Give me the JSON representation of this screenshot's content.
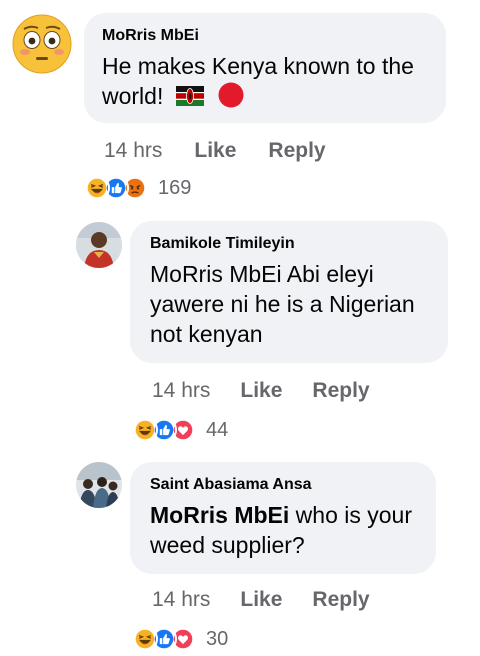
{
  "comments": [
    {
      "author": "MoRris MbEi",
      "mention": "",
      "text": "He makes Kenya known to the world!",
      "time": "14 hrs",
      "like_label": "Like",
      "reply_label": "Reply",
      "reaction_count": "169",
      "reactions": [
        "haha-icon",
        "like-icon",
        "angry-icon"
      ],
      "avatar_icon": "flushed-emoji-icon"
    },
    {
      "author": "Bamikole Timileyin",
      "mention": "",
      "text": "MoRris MbEi Abi eleyi yawere ni  he is a Nigerian not kenyan",
      "time": "14 hrs",
      "like_label": "Like",
      "reply_label": "Reply",
      "reaction_count": "44",
      "reactions": [
        "haha-icon",
        "like-icon",
        "love-icon"
      ],
      "avatar_icon": "user-photo-avatar"
    },
    {
      "author": "Saint Abasiama Ansa",
      "mention": "MoRris MbEi",
      "text": " who is your weed supplier?",
      "time": "14 hrs",
      "like_label": "Like",
      "reply_label": "Reply",
      "reaction_count": "30",
      "reactions": [
        "haha-icon",
        "like-icon",
        "love-icon"
      ],
      "avatar_icon": "group-photo-avatar"
    }
  ],
  "colors": {
    "bubble": "#f0f2f5",
    "meta_text": "#65676b",
    "like_blue": "#1877f2",
    "love_red": "#f33e58",
    "haha_yellow": "#f7b125",
    "angry_orange": "#e9710f"
  }
}
